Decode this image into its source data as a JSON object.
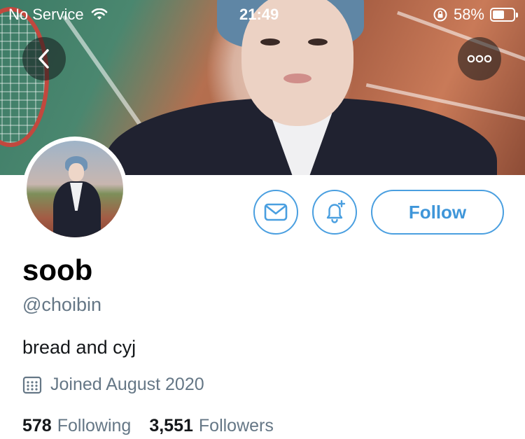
{
  "status_bar": {
    "carrier": "No Service",
    "time": "21:49",
    "battery": "58%",
    "battery_level": 0.58
  },
  "nav": {
    "back_icon": "chevron-left-icon",
    "more_icon": "more-horizontal-icon"
  },
  "profile": {
    "display_name": "soob",
    "handle": "@choibin",
    "bio": "bread and cyj",
    "joined": "Joined August 2020",
    "following_count": "578",
    "following_label": "Following",
    "followers_count": "3,551",
    "followers_label": "Followers"
  },
  "actions": {
    "message_icon": "envelope-icon",
    "notify_icon": "bell-plus-icon",
    "follow_label": "Follow"
  },
  "colors": {
    "accent": "#4a9fe0",
    "secondary_text": "#657786"
  }
}
